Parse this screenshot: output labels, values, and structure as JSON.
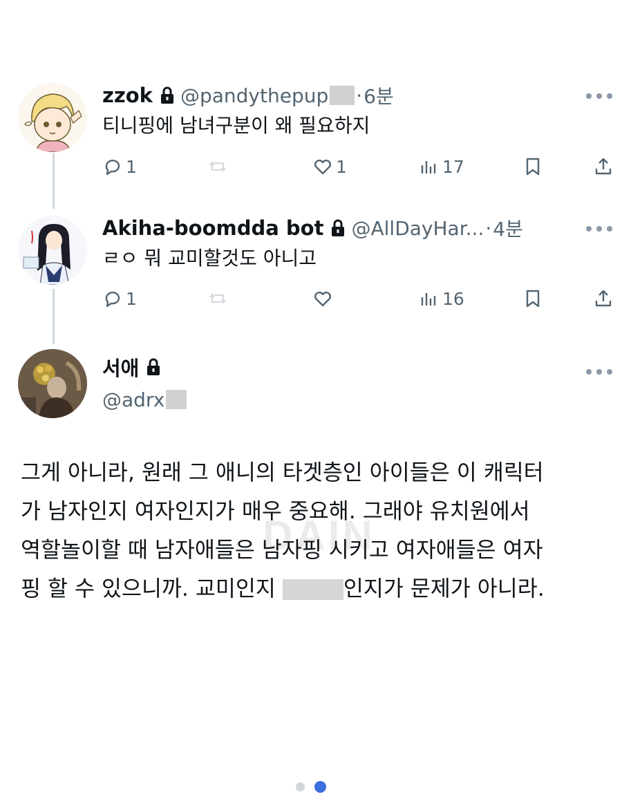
{
  "tweets": [
    {
      "name": "zzok",
      "handle": "@pandythepup",
      "time": "6분",
      "text": "티니핑에 남녀구분이 왜 필요하지",
      "replies": "1",
      "likes": "1",
      "views": "17"
    },
    {
      "name": "Akiha-boomdda bot",
      "handle": "@AllDayHar...",
      "time": "4분",
      "text": "ㄹㅇ 뭐 교미할것도 아니고",
      "replies": "1",
      "likes": "",
      "views": "16"
    },
    {
      "name": "서애",
      "handle": "@adrx"
    }
  ],
  "main_text": {
    "line1": "그게 아니라, 원래 그 애니의 타겟층인 아이들은 이 캐릭터",
    "line2": "가 남자인지 여자인지가 매우 중요해. 그래야 유치원에서",
    "line3": "역할놀이할 때 남자애들은 남자핑 시키고 여자애들은 여자",
    "line4a": "핑 할 수 있으니까. 교미인지 ",
    "line4b": "인지가 문제가 아니라."
  },
  "watermark": "DAIN",
  "pager": {
    "count": 2,
    "active": 2
  },
  "colors": {
    "text": "#0f1419",
    "muted": "#536471",
    "accent": "#3b6fe0",
    "thread": "#cfd9de"
  },
  "icons": [
    "lock-icon",
    "reply-icon",
    "retweet-icon",
    "like-icon",
    "views-icon",
    "bookmark-icon",
    "share-icon",
    "more-icon"
  ]
}
